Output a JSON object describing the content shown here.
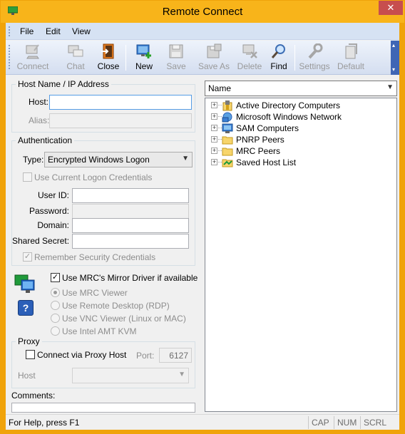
{
  "window": {
    "title": "Remote Connect",
    "close_glyph": "✕"
  },
  "menu": {
    "items": [
      "File",
      "Edit",
      "View"
    ]
  },
  "toolbar": {
    "buttons": [
      {
        "label": "Connect",
        "icon": "connect-icon",
        "enabled": false
      },
      {
        "label": "Chat",
        "icon": "chat-icon",
        "enabled": false
      },
      {
        "label": "Close",
        "icon": "close-door-icon",
        "enabled": true
      },
      {
        "label": "New",
        "icon": "new-computer-icon",
        "enabled": true
      },
      {
        "label": "Save",
        "icon": "save-icon",
        "enabled": false
      },
      {
        "label": "Save As",
        "icon": "save-as-icon",
        "enabled": false
      },
      {
        "label": "Delete",
        "icon": "delete-icon",
        "enabled": false
      },
      {
        "label": "Find",
        "icon": "find-icon",
        "enabled": true
      },
      {
        "label": "Settings",
        "icon": "wrench-icon",
        "enabled": false
      },
      {
        "label": "Default",
        "icon": "default-icon",
        "enabled": false
      }
    ]
  },
  "host_group": {
    "title": "Host Name / IP Address",
    "host_label": "Host:",
    "host_value": "",
    "alias_label": "Alias:",
    "alias_value": ""
  },
  "auth_group": {
    "title": "Authentication",
    "type_label": "Type:",
    "type_value": "Encrypted Windows Logon",
    "use_current_label": "Use Current Logon Credentials",
    "use_current_checked": false,
    "userid_label": "User ID:",
    "password_label": "Password:",
    "domain_label": "Domain:",
    "shared_secret_label": "Shared Secret:",
    "remember_label": "Remember Security Credentials",
    "remember_checked": true
  },
  "viewer": {
    "mirror_label": "Use MRC's Mirror Driver if available",
    "mirror_checked": true,
    "options": [
      {
        "label": "Use MRC Viewer",
        "selected": true
      },
      {
        "label": "Use Remote Desktop (RDP)",
        "selected": false
      },
      {
        "label": "Use VNC Viewer (Linux or MAC)",
        "selected": false
      },
      {
        "label": "Use Intel AMT KVM",
        "selected": false
      }
    ],
    "help_glyph": "?"
  },
  "proxy_group": {
    "title": "Proxy",
    "connect_label": "Connect via Proxy Host",
    "connect_checked": false,
    "port_label": "Port:",
    "port_value": "6127",
    "host_label": "Host",
    "host_value": ""
  },
  "comments": {
    "label": "Comments:",
    "value": ""
  },
  "browser": {
    "view_select": "Name",
    "tree": [
      {
        "label": "Active Directory Computers",
        "icon": "active-directory-icon"
      },
      {
        "label": "Microsoft Windows Network",
        "icon": "network-icon"
      },
      {
        "label": "SAM Computers",
        "icon": "computer-icon"
      },
      {
        "label": "PNRP Peers",
        "icon": "folder-icon"
      },
      {
        "label": "MRC Peers",
        "icon": "folder-icon"
      },
      {
        "label": "Saved Host List",
        "icon": "saved-folder-icon"
      }
    ],
    "expand_glyph": "+"
  },
  "statusbar": {
    "text": "For Help, press F1",
    "panes": [
      "CAP",
      "NUM",
      "SCRL"
    ]
  },
  "colors": {
    "title_bar": "#f8b41a",
    "toolbar_bg": "#d4def0",
    "close_button": "#c74e4e",
    "accent_blue": "#1f4ea8"
  }
}
